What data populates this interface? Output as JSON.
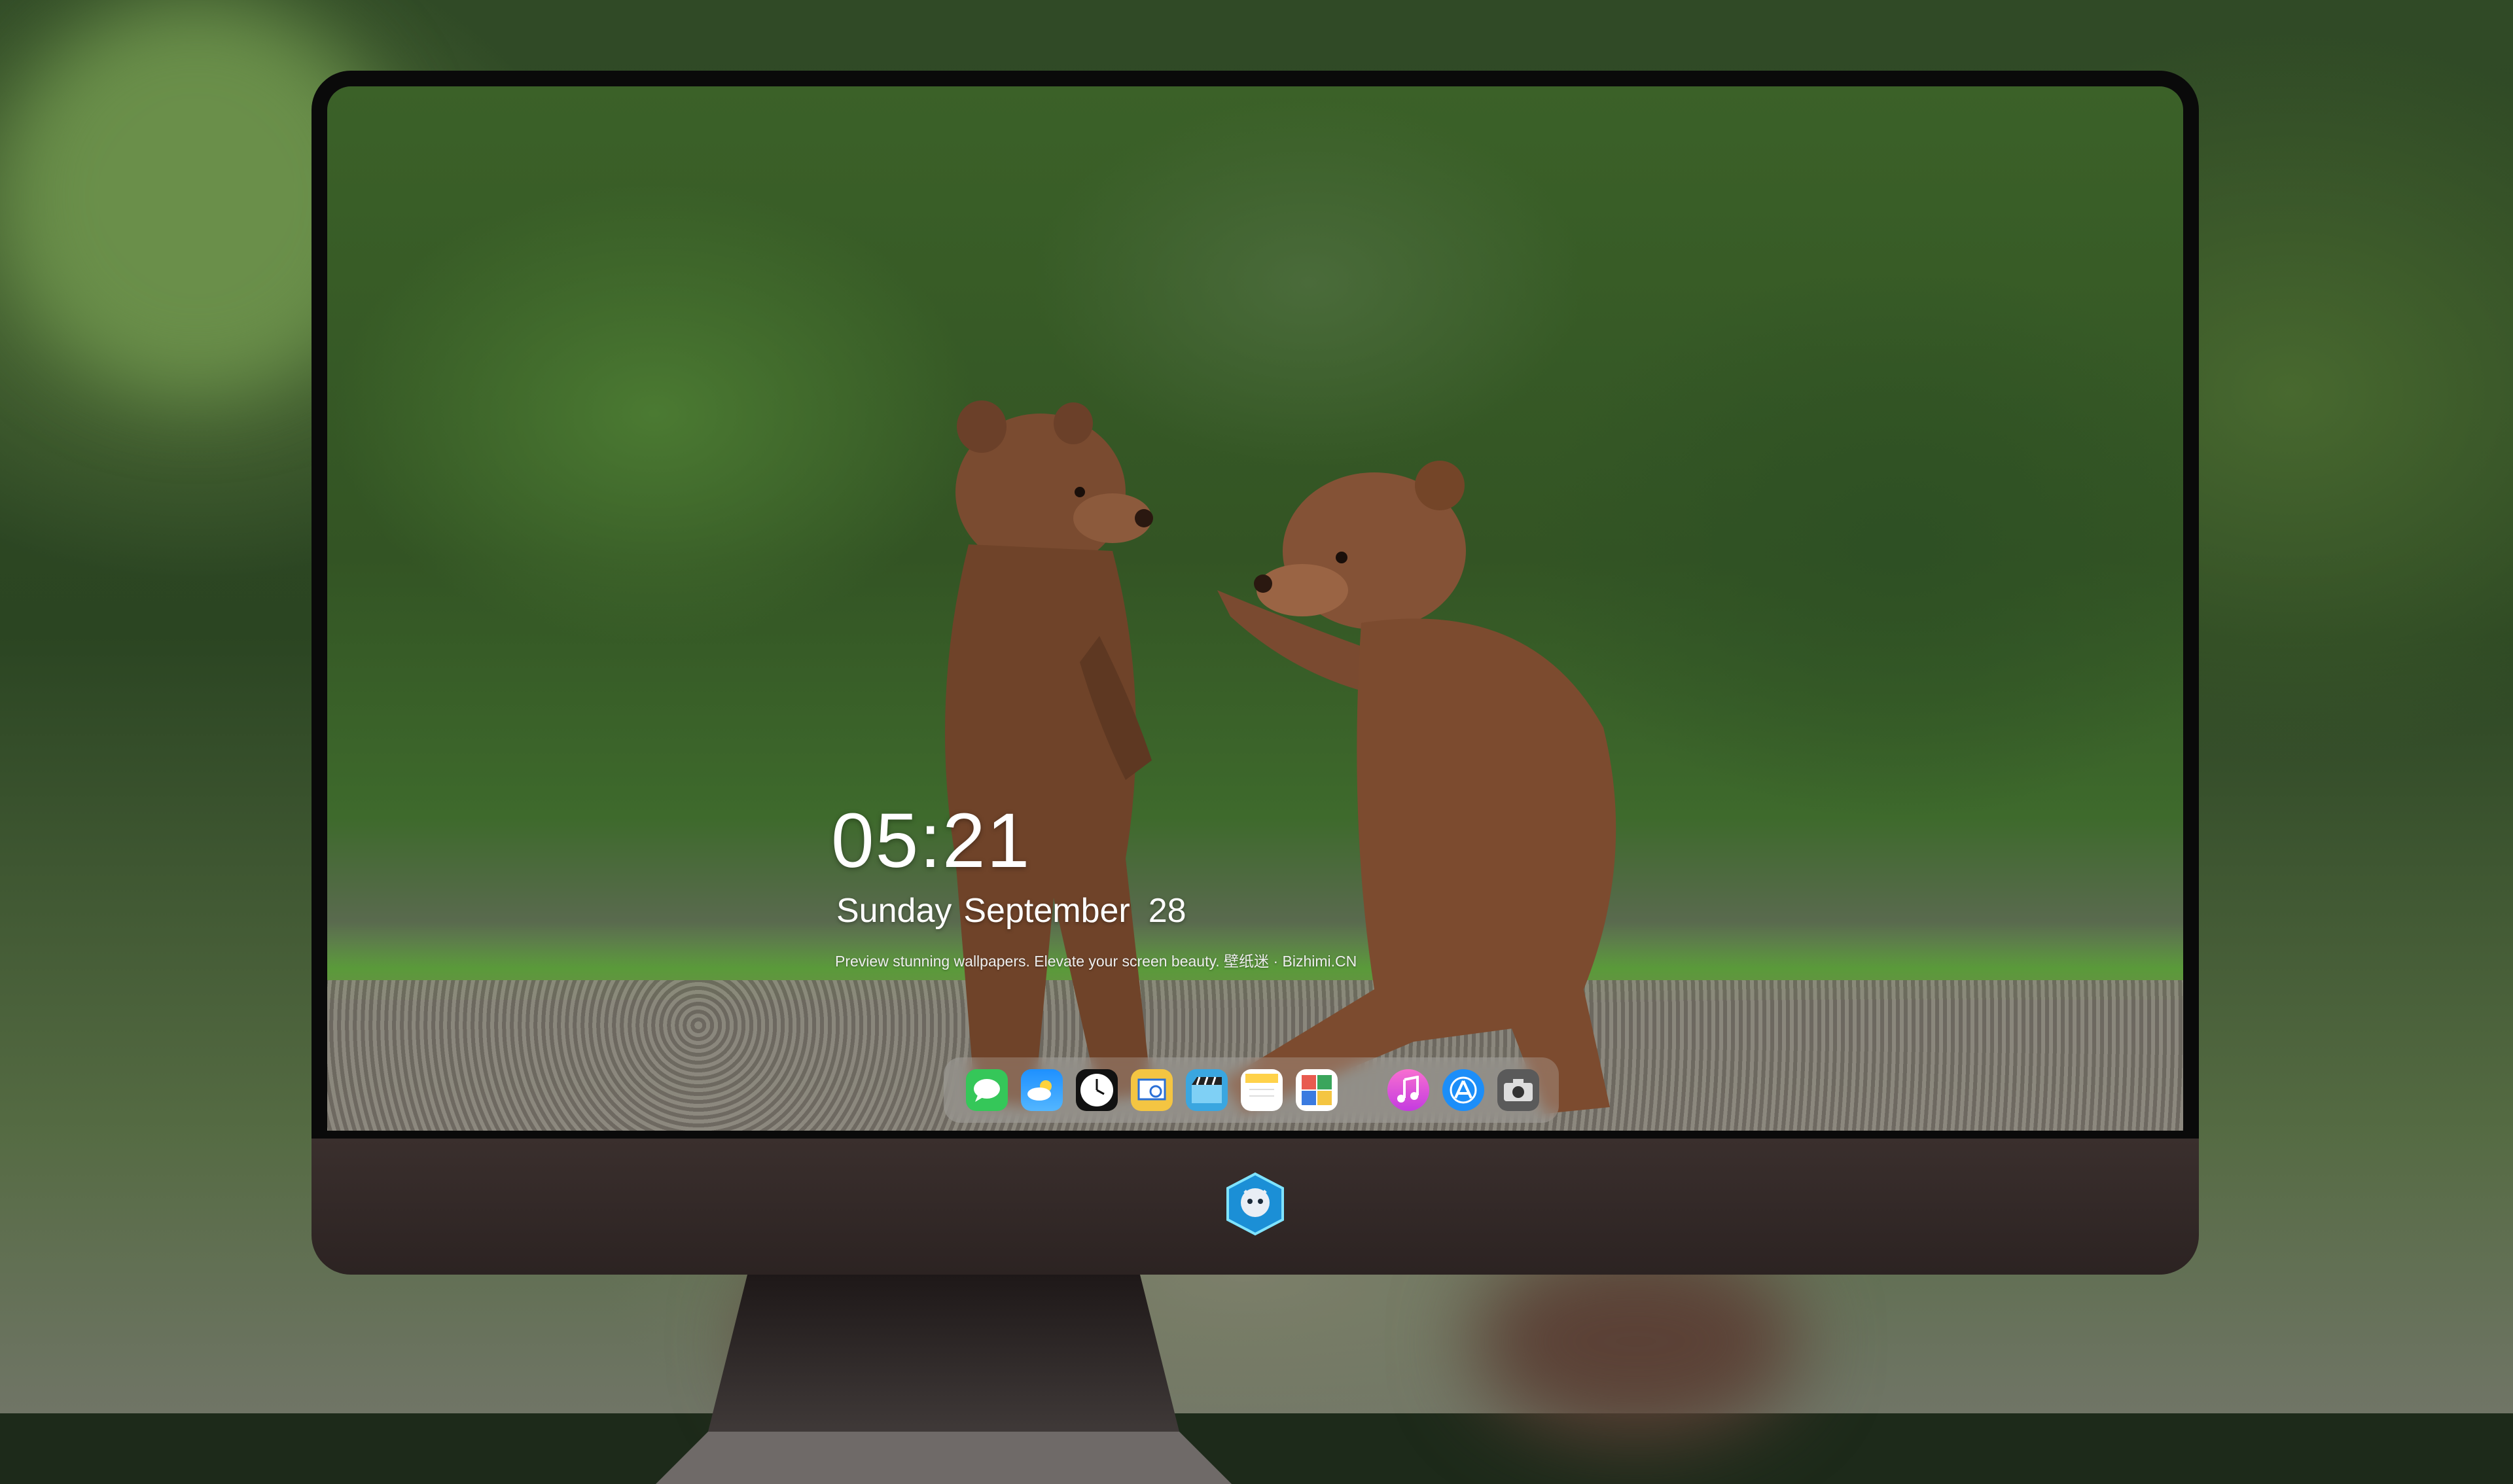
{
  "lockscreen": {
    "time": "05:21",
    "weekday": "Sunday",
    "month": "September",
    "day": "28",
    "tagline": "Preview stunning wallpapers. Elevate your screen beauty. 壁纸迷 · Bizhimi.CN"
  },
  "dock": {
    "apps": [
      {
        "name": "messages-icon",
        "color": "#35c759"
      },
      {
        "name": "weather-icon",
        "color": "#1e90ff"
      },
      {
        "name": "clock-icon",
        "color": "#111111"
      },
      {
        "name": "preview-icon",
        "color": "#f4c542"
      },
      {
        "name": "clips-icon",
        "color": "#3aa6e0"
      },
      {
        "name": "notes-icon",
        "color": "#ffd24a"
      },
      {
        "name": "photo-booth-icon",
        "color": "#e85a4f"
      },
      {
        "name": "music-icon",
        "color": "#f04fb4"
      },
      {
        "name": "app-store-icon",
        "color": "#1c8ef9"
      },
      {
        "name": "camera-icon",
        "color": "#5a5a5a"
      }
    ]
  },
  "colors": {
    "bezel": "#0a0a0a",
    "chin": "#2c2322",
    "text": "#ffffff"
  }
}
